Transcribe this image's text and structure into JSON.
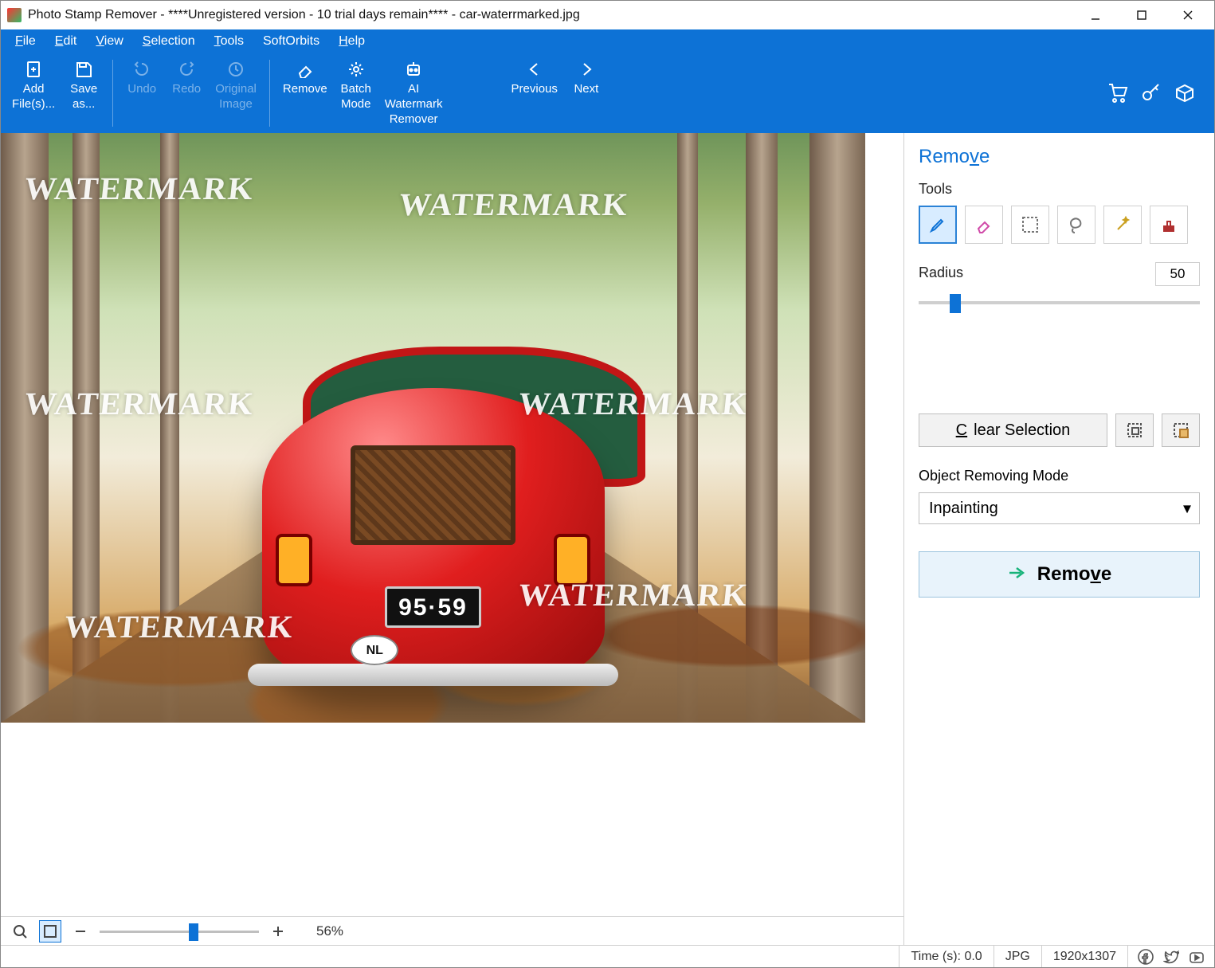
{
  "title": "Photo Stamp Remover - ****Unregistered version - 10 trial days remain**** - car-waterrmarked.jpg",
  "menu": {
    "file": "File",
    "edit": "Edit",
    "view": "View",
    "selection": "Selection",
    "tools": "Tools",
    "softorbits": "SoftOrbits",
    "help": "Help"
  },
  "ribbon": {
    "add": "Add File(s)...",
    "save": "Save as...",
    "undo": "Undo",
    "redo": "Redo",
    "original": "Original Image",
    "remove": "Remove",
    "batch": "Batch Mode",
    "ai": "AI Watermark Remover",
    "prev": "Previous",
    "next": "Next"
  },
  "canvas": {
    "plate": "95·59",
    "oval": "NL",
    "watermarks": [
      "WATERMARK",
      "WATERMARK",
      "WATERMARK",
      "WATERMARK",
      "WATERMARK",
      "WATERMARK"
    ]
  },
  "panel": {
    "title": "Remove",
    "tools_label": "Tools",
    "radius_label": "Radius",
    "radius_value": "50",
    "slider_pos_pct": 11,
    "clear": "Clear Selection",
    "mode_label": "Object Removing Mode",
    "mode_value": "Inpainting",
    "remove": "Remove"
  },
  "zoom": {
    "percent": "56%",
    "slider_pos_pct": 56
  },
  "status": {
    "time": "Time (s): 0.0",
    "format": "JPG",
    "dims": "1920x1307"
  }
}
